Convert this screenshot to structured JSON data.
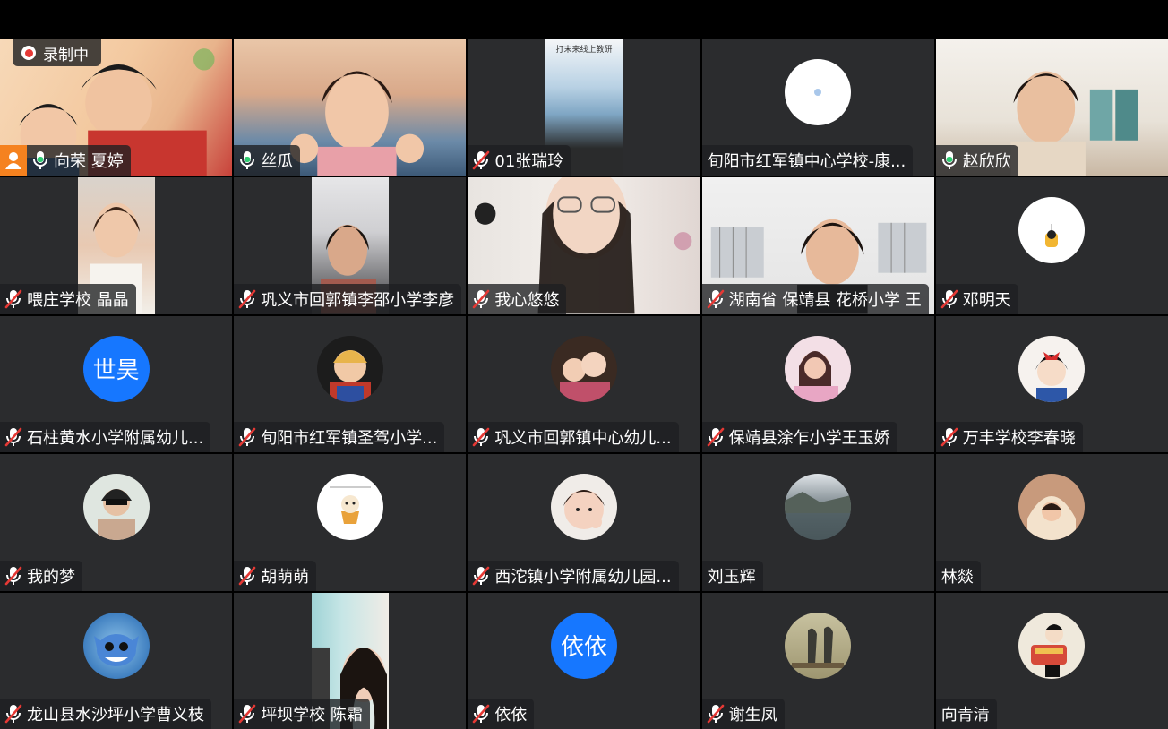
{
  "recording": {
    "label": "录制中"
  },
  "colors": {
    "speaking_border": "#2ecc71",
    "text_avatar_bg": "#1677ff",
    "mic_muted": "#e53935",
    "tile_bg": "#2b2c2e"
  },
  "participants": [
    {
      "name": "向荣 夏婷",
      "mic": "on",
      "speaking": true,
      "display": "video"
    },
    {
      "name": "丝瓜",
      "mic": "on",
      "display": "video"
    },
    {
      "name": "01张瑞玲",
      "mic": "muted",
      "display": "video",
      "video_caption": "打末来线上教研"
    },
    {
      "name": "旬阳市红军镇中心学校-康...",
      "mic": "none",
      "display": "avatar"
    },
    {
      "name": "赵欣欣",
      "mic": "on",
      "display": "video"
    },
    {
      "name": "喂庄学校 晶晶",
      "mic": "muted",
      "display": "video"
    },
    {
      "name": "巩义市回郭镇李邵小学李彦",
      "mic": "muted",
      "display": "video"
    },
    {
      "name": "我心悠悠",
      "mic": "muted",
      "display": "video"
    },
    {
      "name": "湖南省 保靖县 花桥小学 王",
      "mic": "muted",
      "display": "video"
    },
    {
      "name": "邓明天",
      "mic": "muted",
      "display": "avatar"
    },
    {
      "name": "石柱黄水小学附属幼儿...",
      "mic": "muted",
      "display": "avatar",
      "avatar_text": "世昊"
    },
    {
      "name": "旬阳市红军镇圣驾小学...",
      "mic": "muted",
      "display": "avatar"
    },
    {
      "name": "巩义市回郭镇中心幼儿...",
      "mic": "muted",
      "display": "avatar"
    },
    {
      "name": "保靖县涂乍小学王玉娇",
      "mic": "muted",
      "display": "avatar"
    },
    {
      "name": "万丰学校李春晓",
      "mic": "muted",
      "display": "avatar"
    },
    {
      "name": "我的梦",
      "mic": "muted",
      "display": "avatar"
    },
    {
      "name": "胡萌萌",
      "mic": "muted",
      "display": "avatar"
    },
    {
      "name": "西沱镇小学附属幼儿园...",
      "mic": "muted",
      "display": "avatar"
    },
    {
      "name": "刘玉辉",
      "mic": "none",
      "display": "avatar"
    },
    {
      "name": "林燚",
      "mic": "none",
      "display": "avatar"
    },
    {
      "name": "龙山县水沙坪小学曹义枝",
      "mic": "muted",
      "display": "avatar"
    },
    {
      "name": "坪坝学校 陈霜",
      "mic": "muted",
      "display": "video"
    },
    {
      "name": "依依",
      "mic": "muted",
      "display": "avatar",
      "avatar_text": "依依"
    },
    {
      "name": "谢生凤",
      "mic": "muted",
      "display": "avatar"
    },
    {
      "name": "向青清",
      "mic": "none",
      "display": "avatar"
    }
  ]
}
